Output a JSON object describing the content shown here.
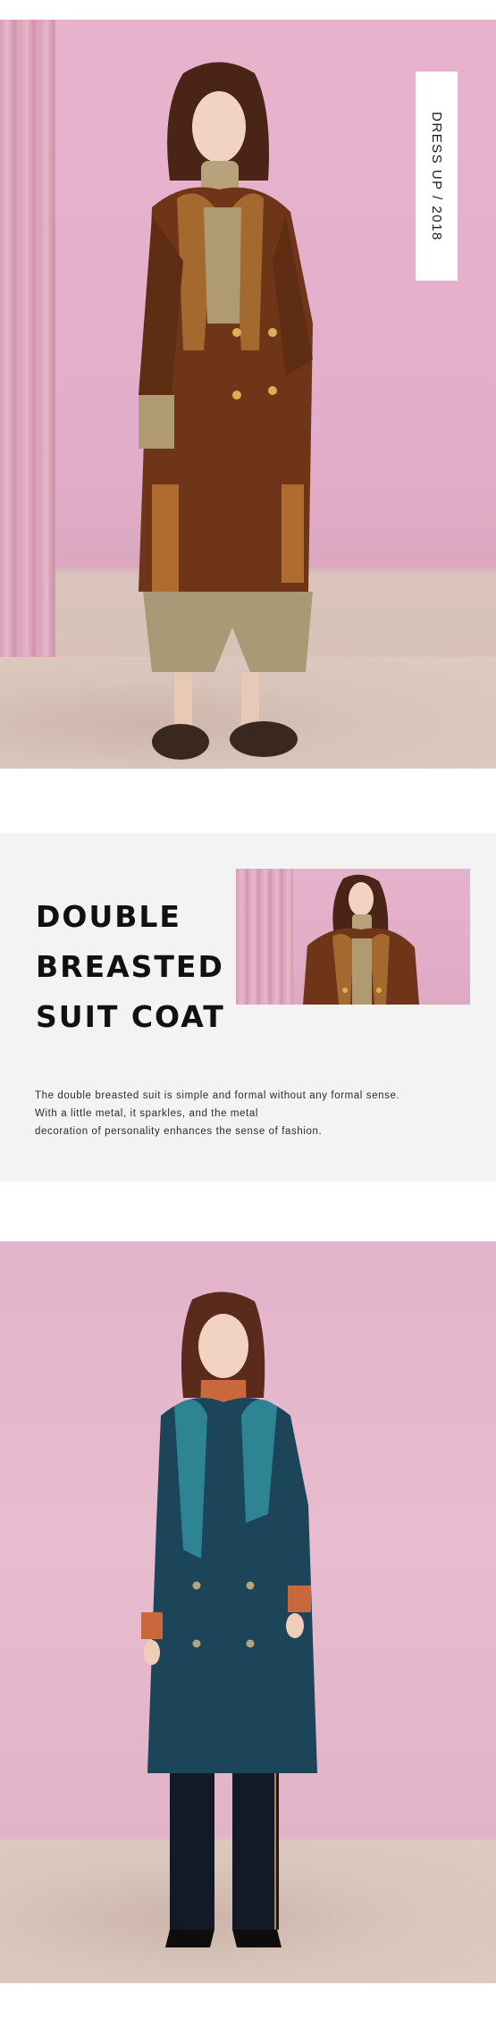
{
  "tag": {
    "text": "DRESS UP / 2018"
  },
  "headline": {
    "lines": [
      "DOUBLE",
      "BREASTED",
      "SUIT COAT"
    ]
  },
  "description": {
    "lines": [
      "The double breasted suit is simple and formal without any formal sense.",
      "With a little metal, it sparkles, and the metal",
      "decoration of personality enhances the sense of fashion."
    ]
  },
  "colors": {
    "background_pink": "#e5b2cc",
    "panel_gray": "#f3f3f3",
    "coat_brown": "#6e3518",
    "coat_teal": "#1c4559",
    "text_dark": "#111111"
  }
}
